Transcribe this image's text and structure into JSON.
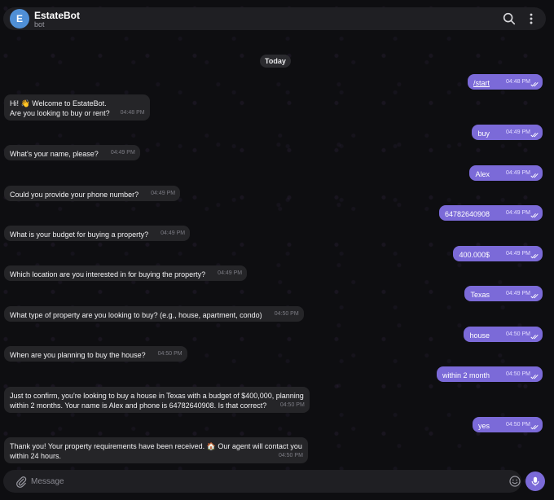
{
  "header": {
    "avatar_letter": "E",
    "title": "EstateBot",
    "status": "bot"
  },
  "date_label": "Today",
  "messages": [
    {
      "dir": "out",
      "text": "/start",
      "time": "04:48 PM"
    },
    {
      "dir": "in",
      "lines": [
        "Hi! 👋 Welcome to EstateBot.",
        "Are you looking to buy or rent?"
      ],
      "time": "04:48 PM"
    },
    {
      "dir": "out",
      "text": "buy",
      "time": "04:49 PM"
    },
    {
      "dir": "in",
      "text": "What's your name, please?",
      "time": "04:49 PM"
    },
    {
      "dir": "out",
      "text": "Alex",
      "time": "04:49 PM"
    },
    {
      "dir": "in",
      "text": "Could you provide your phone number?",
      "time": "04:49 PM"
    },
    {
      "dir": "out",
      "text": "64782640908",
      "time": "04:49 PM"
    },
    {
      "dir": "in",
      "text": "What is your budget for buying a property?",
      "time": "04:49 PM"
    },
    {
      "dir": "out",
      "text": "400.000$",
      "time": "04:49 PM"
    },
    {
      "dir": "in",
      "text": "Which location are you interested in for buying the property?",
      "time": "04:49 PM"
    },
    {
      "dir": "out",
      "text": "Texas",
      "time": "04:49 PM"
    },
    {
      "dir": "in",
      "text": "What type of property are you looking to buy? (e.g., house, apartment, condo)",
      "time": "04:50 PM"
    },
    {
      "dir": "out",
      "text": "house",
      "time": "04:50 PM"
    },
    {
      "dir": "in",
      "text": "When are you planning to buy the house?",
      "time": "04:50 PM"
    },
    {
      "dir": "out",
      "text": "within 2 month",
      "time": "04:50 PM"
    },
    {
      "dir": "in",
      "lines": [
        "Just to confirm, you're looking to buy a house in Texas with a budget of $400,000, planning",
        "within 2 months. Your name is Alex and phone is 64782640908. Is that correct?"
      ],
      "time": "04:50 PM"
    },
    {
      "dir": "out",
      "text": "yes",
      "time": "04:50 PM"
    },
    {
      "dir": "in",
      "lines": [
        "Thank you! Your property requirements have been received. 🏠  Our agent will contact you",
        "within 24 hours."
      ],
      "time": "04:50 PM"
    }
  ],
  "composer": {
    "placeholder": "Message"
  },
  "icons": {
    "search": "search-icon",
    "menu": "more-vertical-icon",
    "attach": "paperclip-icon",
    "emoji": "emoji-icon",
    "mic": "microphone-icon",
    "read": "double-check-icon"
  },
  "colors": {
    "outgoing_bubble": "#7b6ad8",
    "incoming_bubble": "#252528",
    "avatar": "#4f8fd6"
  }
}
